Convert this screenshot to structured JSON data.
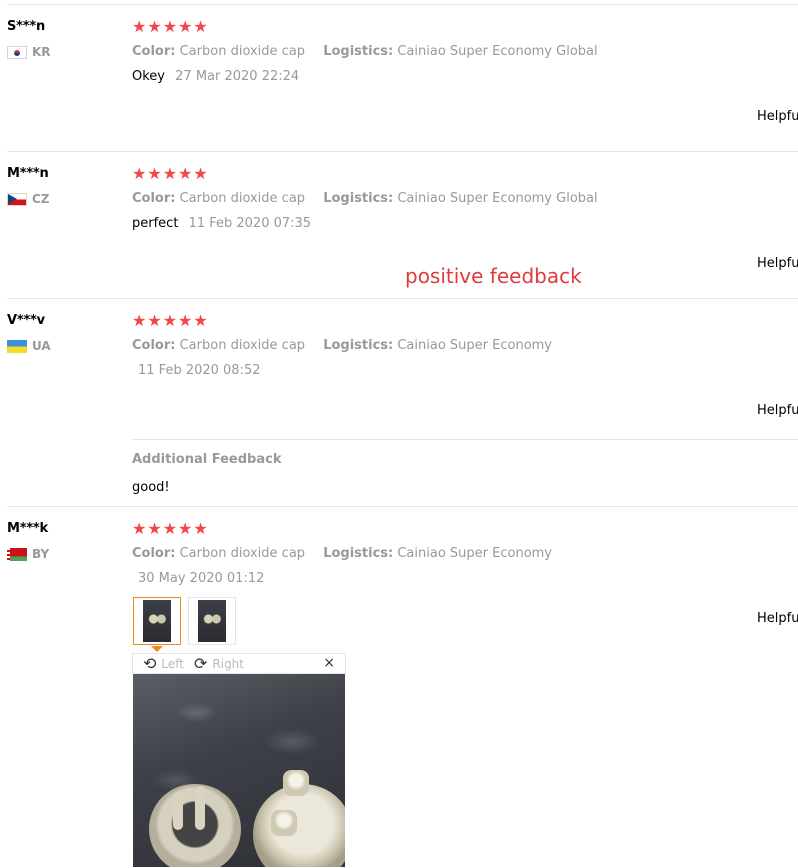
{
  "reviews": [
    {
      "user": "S***n",
      "country": "KR",
      "stars": "★★★★★",
      "color_label": "Color:",
      "color_value": "Carbon dioxide cap",
      "logistics_label": "Logistics:",
      "logistics_value": "Cainiao Super Economy Global",
      "text": "Okey",
      "date": "27 Mar 2020 22:24",
      "helpful": "Helpful"
    },
    {
      "user": "M***n",
      "country": "CZ",
      "stars": "★★★★★",
      "color_label": "Color:",
      "color_value": "Carbon dioxide cap",
      "logistics_label": "Logistics:",
      "logistics_value": "Cainiao Super Economy Global",
      "text": "perfect",
      "date": "11 Feb 2020 07:35",
      "helpful": "Helpful"
    },
    {
      "user": "V***v",
      "country": "UA",
      "stars": "★★★★★",
      "color_label": "Color:",
      "color_value": "Carbon dioxide cap",
      "logistics_label": "Logistics:",
      "logistics_value": "Cainiao Super Economy",
      "text": "",
      "date": "11 Feb 2020 08:52",
      "helpful": "Helpful",
      "additional_title": "Additional Feedback",
      "additional_text": "good!"
    },
    {
      "user": "M***k",
      "country": "BY",
      "stars": "★★★★★",
      "color_label": "Color:",
      "color_value": "Carbon dioxide cap",
      "logistics_label": "Logistics:",
      "logistics_value": "Cainiao Super Economy",
      "text": "",
      "date": "30 May 2020 01:12",
      "helpful": "Helpful"
    }
  ],
  "overlay_label": "positive feedback",
  "viewer": {
    "rotate_left": "Left",
    "rotate_right": "Right",
    "close": "×",
    "rotate_left_icon": "rotate-left-icon",
    "rotate_right_icon": "rotate-right-icon"
  },
  "colors": {
    "star": "#f2484a",
    "muted_text": "#999999",
    "overlay_text": "#e03a3a",
    "active_thumb_border": "#f08a1c"
  }
}
